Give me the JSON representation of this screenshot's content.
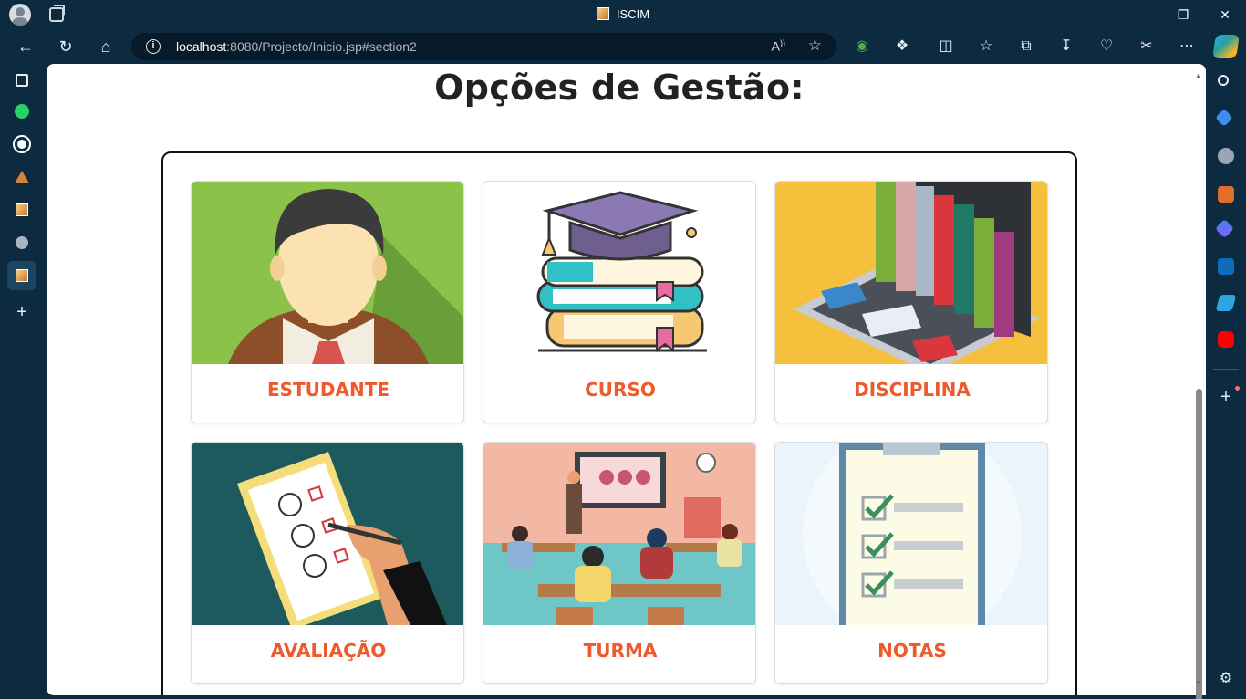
{
  "browser": {
    "window_title": "ISCIM",
    "url_host": "localhost",
    "url_path": ":8080/Projecto/Inicio.jsp#section2",
    "read_aloud_label": "A̧"
  },
  "page": {
    "heading": "Opções de Gestão:",
    "cards": [
      {
        "label": "ESTUDANTE"
      },
      {
        "label": "CURSO"
      },
      {
        "label": "DISCIPLINA"
      },
      {
        "label": "AVALIAÇÃO"
      },
      {
        "label": "TURMA"
      },
      {
        "label": "NOTAS"
      }
    ]
  },
  "colors": {
    "accent_label": "#ee5a2b",
    "browser_chrome": "#0c2a40"
  }
}
